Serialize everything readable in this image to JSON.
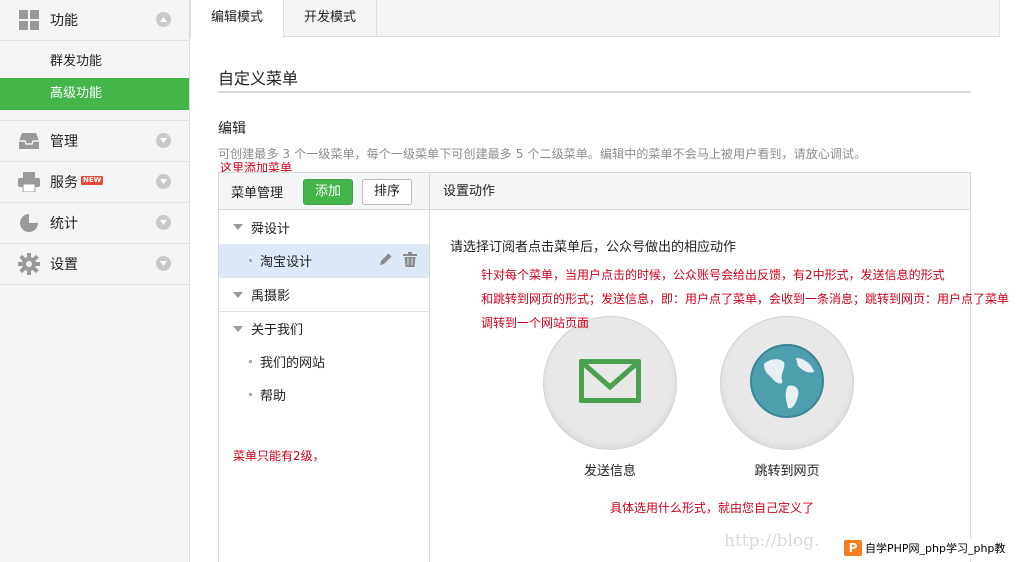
{
  "sidebar": {
    "sections": [
      {
        "label": "功能",
        "icon": "grid-icon"
      },
      {
        "label": "管理",
        "icon": "inbox-icon"
      },
      {
        "label": "服务",
        "icon": "printer-icon",
        "badge": "NEW"
      },
      {
        "label": "统计",
        "icon": "pie-chart-icon"
      },
      {
        "label": "设置",
        "icon": "gear-icon"
      }
    ],
    "sub_items": [
      "群发功能",
      "高级功能"
    ],
    "active_sub": "高级功能"
  },
  "tabs": [
    "编辑模式",
    "开发模式"
  ],
  "active_tab": "编辑模式",
  "page_title": "自定义菜单",
  "edit_section": {
    "title": "编辑",
    "description": "可创建最多 3 个一级菜单，每个一级菜单下可创建最多 5 个二级菜单。编辑中的菜单不会马上被用户看到，请放心调试。"
  },
  "annotations": {
    "add_here": "这里添加菜单",
    "levels": "菜单只能有2级，",
    "explain_line1": "针对每个菜单，当用户点击的时候，公众账号会给出反馈，有2中形式，发送信息的形式",
    "explain_line2": "和跳转到网页的形式；发送信息，即：用户点了菜单，会收到一条消息；跳转到网页：用户点了菜单",
    "explain_line3": "调转到一个网站页面",
    "choose": "具体选用什么形式，就由您自己定义了"
  },
  "menu_panel": {
    "header_label": "菜单管理",
    "add_button": "添加",
    "sort_button": "排序",
    "action_header": "设置动作",
    "menus": [
      {
        "name": "舜设计",
        "children": [
          "淘宝设计"
        ]
      },
      {
        "name": "禹摄影",
        "children": []
      },
      {
        "name": "关于我们",
        "children": [
          "我们的网站",
          "帮助"
        ]
      }
    ],
    "selected_item": "淘宝设计"
  },
  "action": {
    "prompt": "请选择订阅者点击菜单后，公众号做出的相应动作",
    "options": [
      {
        "label": "发送信息",
        "icon": "envelope-icon"
      },
      {
        "label": "跳转到网页",
        "icon": "globe-icon"
      }
    ]
  },
  "watermark": "http://blog.",
  "logo": {
    "letter": "P",
    "text": "自学PHP网_php学习_php教"
  },
  "colors": {
    "accent_green": "#44b549",
    "annotation_red": "#d0021b",
    "selected_row": "#dde9f6"
  }
}
